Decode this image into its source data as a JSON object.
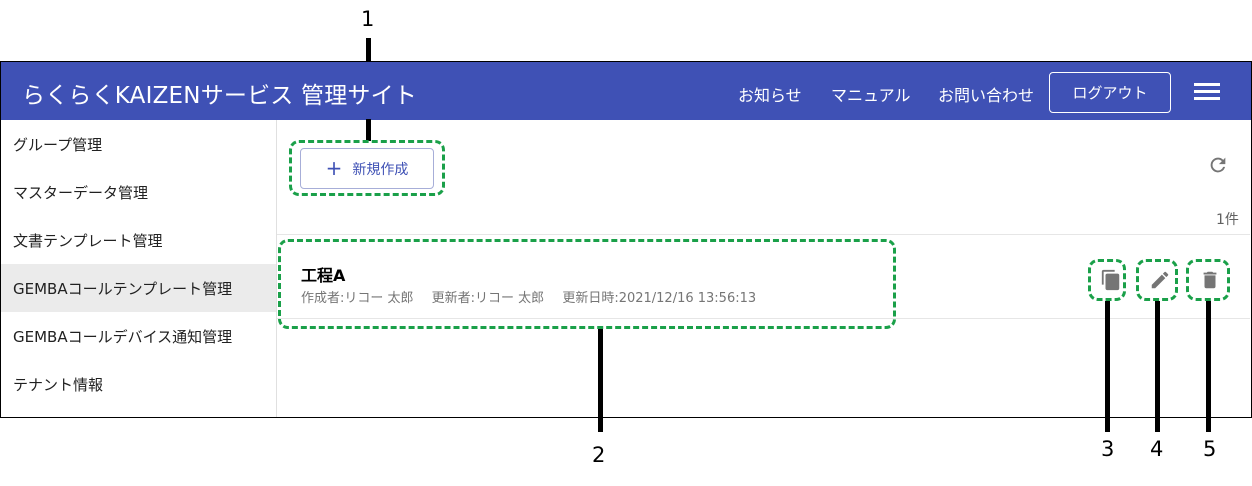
{
  "header": {
    "title": "らくらくKAIZENサービス 管理サイト",
    "nav": [
      "お知らせ",
      "マニュアル",
      "お問い合わせ"
    ],
    "logout_label": "ログアウト",
    "menu_icon": "hamburger-menu-icon"
  },
  "sidebar": {
    "items": [
      {
        "label": "グループ管理"
      },
      {
        "label": "マスターデータ管理"
      },
      {
        "label": "文書テンプレート管理"
      },
      {
        "label": "GEMBAコールテンプレート管理"
      },
      {
        "label": "GEMBAコールデバイス通知管理"
      },
      {
        "label": "テナント情報"
      }
    ],
    "active_index": 3
  },
  "toolbar": {
    "new_label": "新規作成",
    "new_icon": "plus-icon",
    "refresh_icon": "refresh-icon"
  },
  "list": {
    "count_text": "1件",
    "rows": [
      {
        "title": "工程A",
        "creator": "作成者:リコー 太郎",
        "updater": "更新者:リコー 太郎",
        "updated_at": "更新日時:2021/12/16 13:56:13",
        "actions": [
          "copy-icon",
          "edit-icon",
          "delete-icon"
        ]
      }
    ]
  },
  "annotations": {
    "labels": [
      "1",
      "2",
      "3",
      "4",
      "5"
    ]
  },
  "colors": {
    "header": "#3f51b5",
    "annotation": "#1aa049",
    "icon": "#757575"
  }
}
